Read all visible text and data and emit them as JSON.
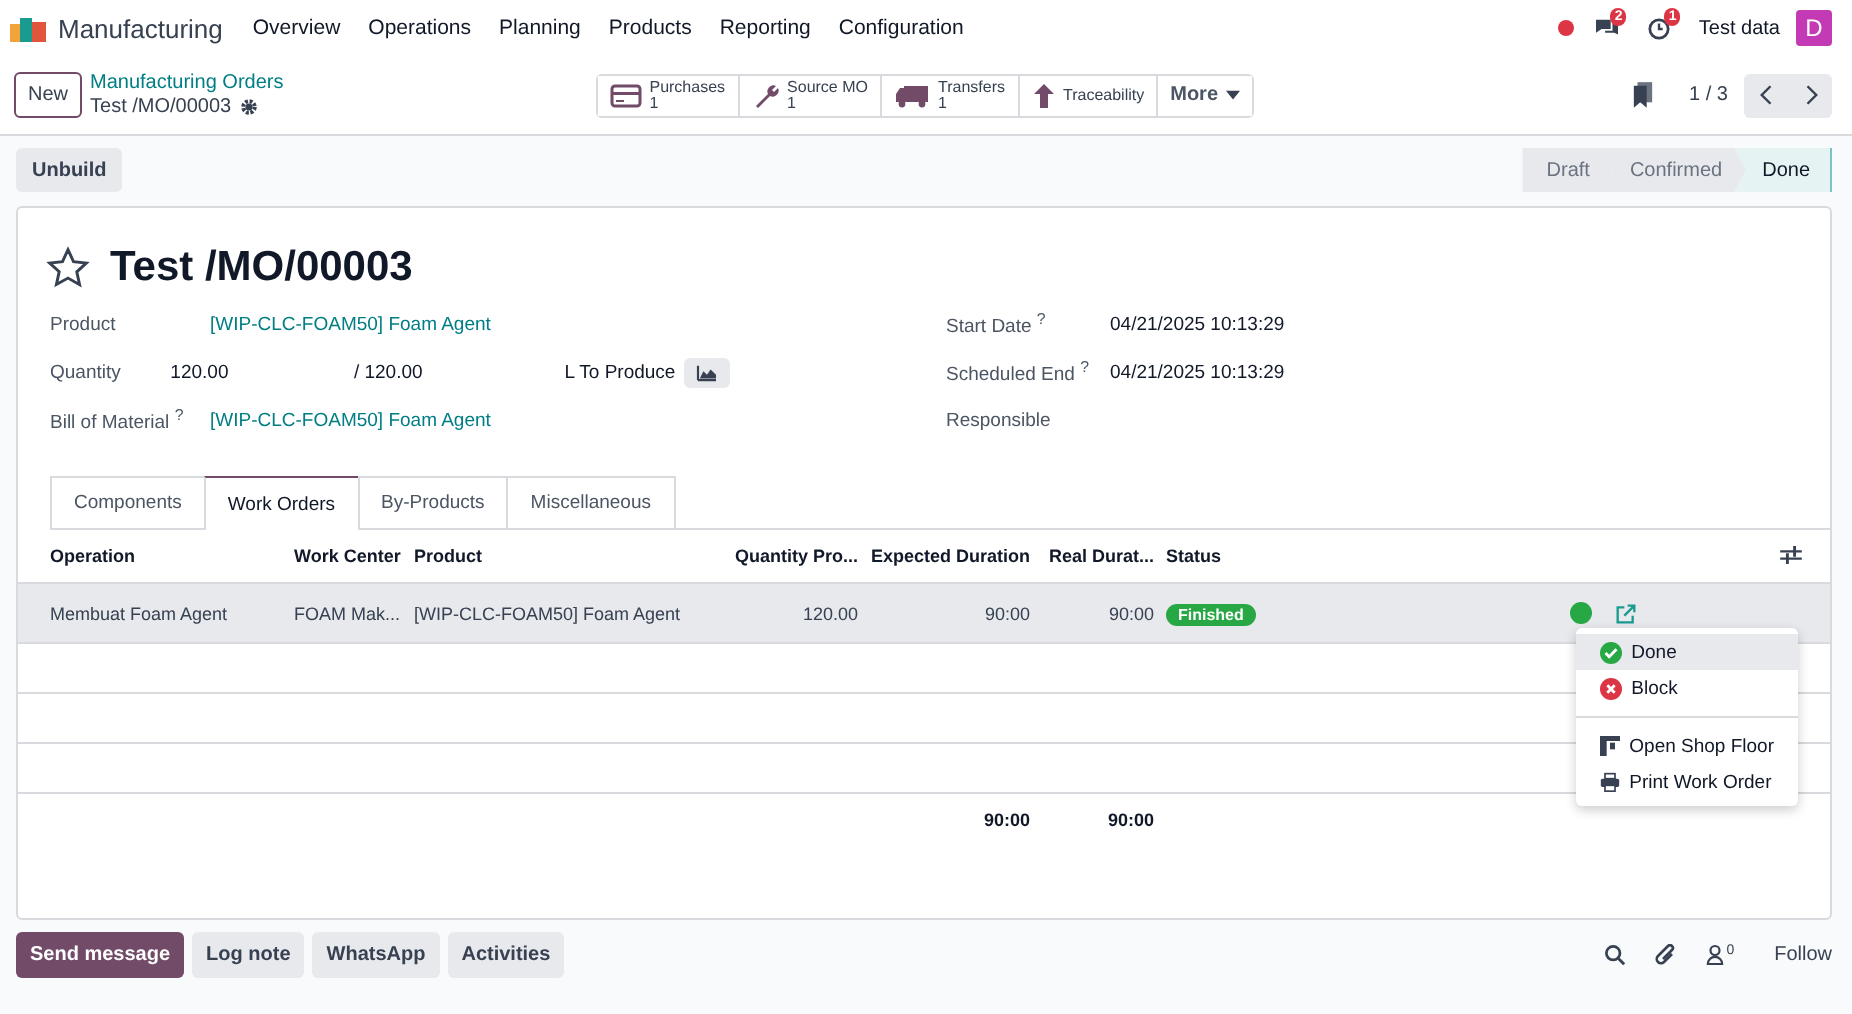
{
  "navbar": {
    "app_name": "Manufacturing",
    "menu": [
      "Overview",
      "Operations",
      "Planning",
      "Products",
      "Reporting",
      "Configuration"
    ],
    "messages_badge": "2",
    "activities_badge": "1",
    "company": "Test data",
    "avatar": "D"
  },
  "control_panel": {
    "new_button": "New",
    "breadcrumb": "Manufacturing Orders",
    "record": "Test /MO/00003",
    "smart_buttons": [
      {
        "kind": "card",
        "label": "Purchases",
        "count": "1"
      },
      {
        "kind": "wrench",
        "label": "Source MO",
        "count": "1"
      },
      {
        "kind": "truck",
        "label": "Transfers",
        "count": "1"
      },
      {
        "kind": "arrow",
        "label": "Traceability"
      }
    ],
    "more": "More",
    "pager": "1 / 3"
  },
  "actions": [
    "Unbuild"
  ],
  "stages": [
    {
      "label": "Draft",
      "selected": false
    },
    {
      "label": "Confirmed",
      "selected": false
    },
    {
      "label": "Done",
      "selected": true
    }
  ],
  "form": {
    "title": "Test /MO/00003",
    "starred": false,
    "left_fields": [
      {
        "label": "Product",
        "value": "[WIP-CLC-FOAM50] Foam Agent",
        "kind": "link"
      },
      {
        "label": "Quantity",
        "value": "120.00",
        "kind": "quantity",
        "of": "/ 120.00",
        "unit": "L To Produce"
      },
      {
        "label": "Bill of Material $^{?}$",
        "value": "[WIP-CLC-FOAM50] Foam Agent",
        "kind": "link"
      }
    ],
    "right_fields": [
      {
        "label": "Start Date $^{?}$",
        "value": "04/21/2025 10:13:29"
      },
      {
        "label": "Scheduled End $^{?}$",
        "value": "04/21/2025 10:13:29"
      },
      {
        "label": "Responsible"
      }
    ]
  },
  "tabs": [
    {
      "label": "Components",
      "selected": false
    },
    {
      "label": "Work Orders",
      "selected": true
    },
    {
      "label": "By-Products",
      "selected": false
    },
    {
      "label": "Miscellaneous",
      "selected": false
    }
  ],
  "table": {
    "columns": [
      "Operation",
      "Work Center",
      "Product",
      "Quantity Pro...",
      "Expected Duration",
      "Real Durat...",
      "Status"
    ],
    "rows": [
      {
        "operation": "Membuat Foam Agent",
        "work_center": "FOAM Mak...",
        "product": "[WIP-CLC-FOAM50] Foam Agent",
        "quantity": "120.00",
        "expected": "90:00",
        "real": "90:00",
        "status": "Finished",
        "color": "#28a745"
      }
    ],
    "totals": {
      "expected": "90:00",
      "real": "90:00"
    }
  },
  "row_menu": [
    [
      {
        "kind": "done",
        "label": "Done",
        "selected": true
      },
      {
        "kind": "block",
        "label": "Block",
        "selected": false
      }
    ],
    [
      {
        "kind": "floor",
        "label": "Open Shop Floor",
        "selected": false
      },
      {
        "kind": "print",
        "label": "Print Work Order",
        "selected": false
      }
    ]
  ],
  "chatter": {
    "buttons": [
      {
        "label": "Send message",
        "selected": true
      },
      {
        "label": "Log note",
        "selected": false
      },
      {
        "label": "WhatsApp",
        "selected": false
      },
      {
        "label": "Activities",
        "selected": false
      }
    ],
    "followers": "0",
    "follow": "Follow"
  }
}
